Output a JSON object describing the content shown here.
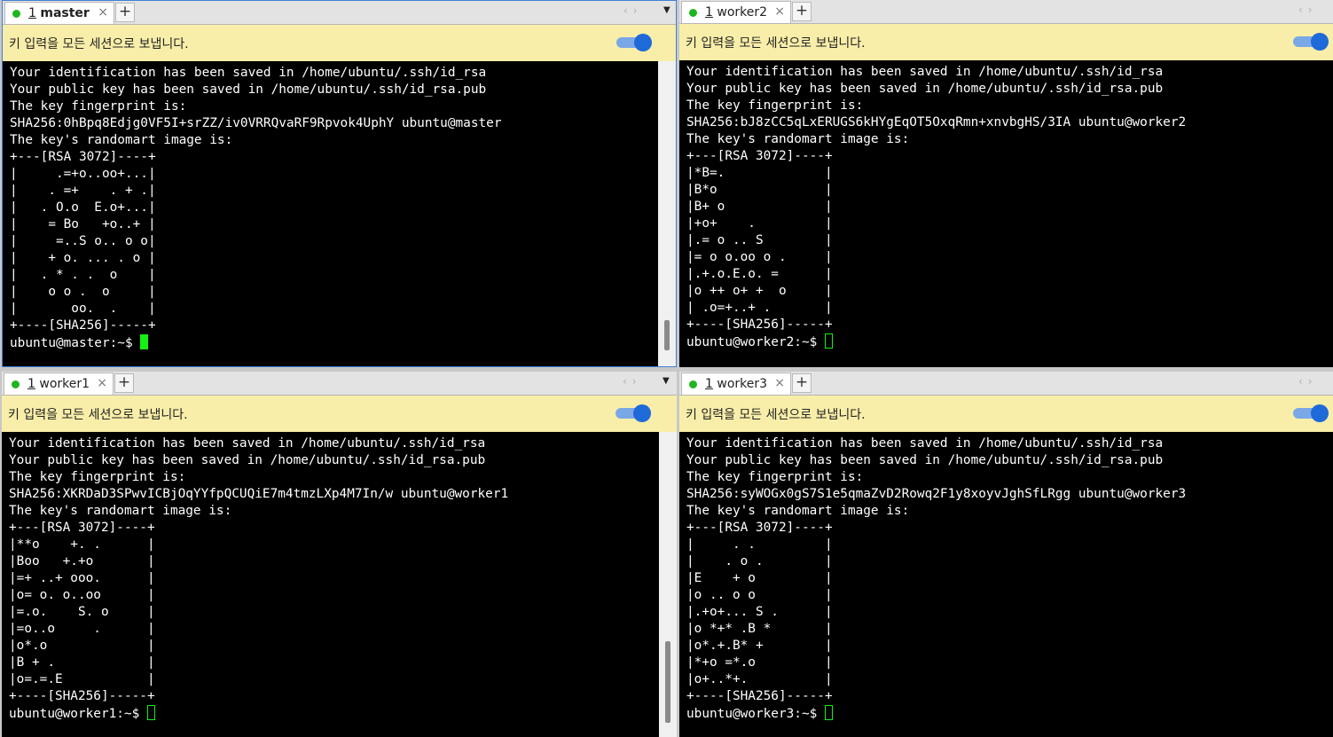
{
  "banner_text": "키 입력을 모든 세션으로 보냅니다.",
  "panes": [
    {
      "tab_number": "1",
      "tab_name": "master",
      "fingerprint": "SHA256:0hBpq8Edjg0VF5I+srZZ/iv0VRRQvaRF9Rpvok4UphY ubuntu@master",
      "art": [
        "|     .=+o..oo+...|",
        "|    . =+    . + .|",
        "|   . O.o  E.o+...|",
        "|    = Bo   +o..+ |",
        "|     =..S o.. o o|",
        "|    + o. ... . o |",
        "|   . * . .  o    |",
        "|    o o .  o     |",
        "|       oo.  .    |"
      ],
      "prompt": "ubuntu@master:~$ "
    },
    {
      "tab_number": "1",
      "tab_name": "worker2",
      "fingerprint": "SHA256:bJ8zCC5qLxERUGS6kHYgEqOT5OxqRmn+xnvbgHS/3IA ubuntu@worker2",
      "art": [
        "|*B=.             |",
        "|B*o              |",
        "|B+ o             |",
        "|+o+    .         |",
        "|.= o .. S        |",
        "|= o o.oo o .     |",
        "|.+.o.E.o. =      |",
        "|o ++ o+ +  o     |",
        "| .o=+..+ .       |"
      ],
      "prompt": "ubuntu@worker2:~$ "
    },
    {
      "tab_number": "1",
      "tab_name": "worker1",
      "fingerprint": "SHA256:XKRDaD3SPwvICBjOqYYfpQCUQiE7m4tmzLXp4M7In/w ubuntu@worker1",
      "art": [
        "|**o    +. .      |",
        "|Boo   +.+o       |",
        "|=+ ..+ ooo.      |",
        "|o= o. o..oo      |",
        "|=.o.    S. o     |",
        "|=o..o     .      |",
        "|o*.o             |",
        "|B + .            |",
        "|o=.=.E           |"
      ],
      "prompt": "ubuntu@worker1:~$ "
    },
    {
      "tab_number": "1",
      "tab_name": "worker3",
      "fingerprint": "SHA256:syWOGx0gS7S1e5qmaZvD2Rowq2F1y8xoyvJghSfLRgg ubuntu@worker3",
      "art": [
        "|     . .         |",
        "|    . o .        |",
        "|E    + o         |",
        "|o .. o o         |",
        "|.+o+... S .      |",
        "|o *+* .B *       |",
        "|o*.+.B* +        |",
        "|*+o =*.o         |",
        "|o+..*+.          |"
      ],
      "prompt": "ubuntu@worker3:~$ "
    }
  ],
  "common_lines": {
    "saved_private": "Your identification has been saved in /home/ubuntu/.ssh/id_rsa",
    "saved_public": "Your public key has been saved in /home/ubuntu/.ssh/id_rsa.pub",
    "fingerprint_label": "The key fingerprint is:",
    "randomart_label": "The key's randomart image is:",
    "art_top": "+---[RSA 3072]----+",
    "art_bottom": "+----[SHA256]-----+"
  },
  "tab_close_glyph": "×",
  "add_tab_glyph": "+",
  "colors": {
    "banner_bg": "#f8eea9",
    "toggle_on": "#1e6ad8",
    "cursor": "#14f014",
    "session_dot": "#1fb51f"
  }
}
